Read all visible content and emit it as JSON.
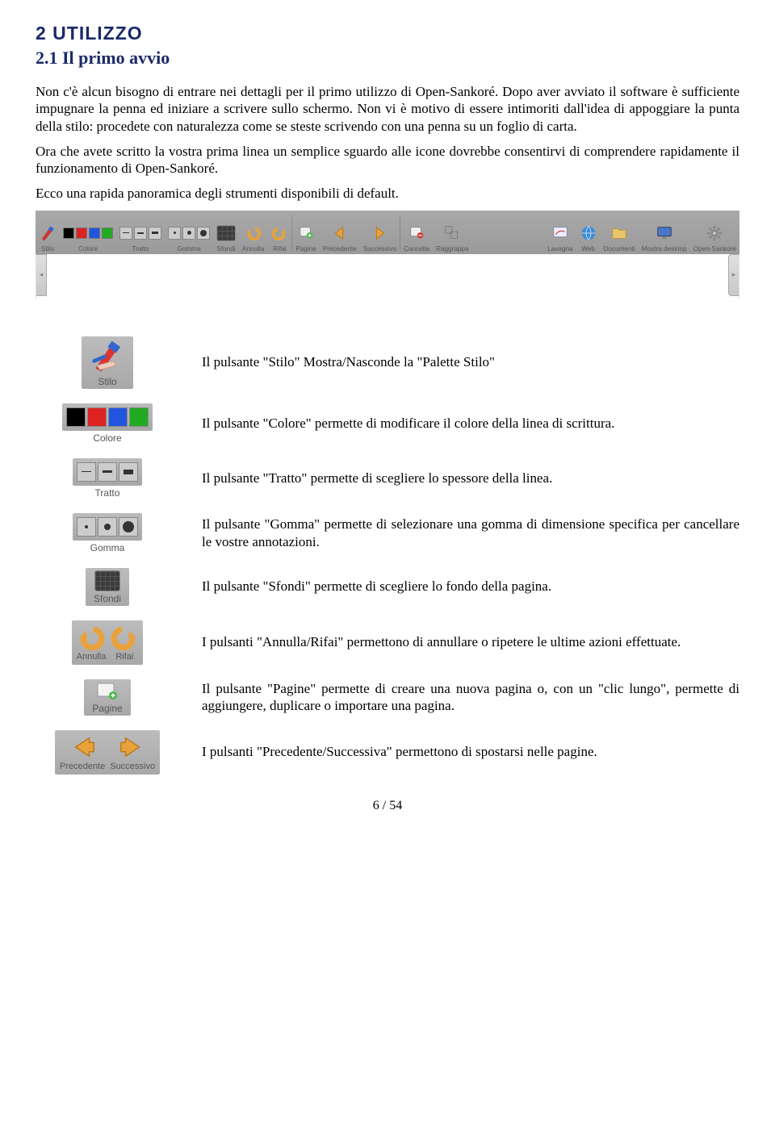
{
  "headings": {
    "h1": "2  UTILIZZO",
    "h2": "2.1 Il primo avvio"
  },
  "paragraphs": {
    "p1": "Non c'è alcun bisogno di entrare nei dettagli per il primo utilizzo di Open-Sankoré. Dopo aver avviato il software è sufficiente impugnare la penna ed iniziare a scrivere sullo schermo. Non vi è motivo di essere intimoriti dall'idea di appoggiare la punta della stilo: procedete con naturalezza come se steste scrivendo con una penna su un foglio di carta.",
    "p2": "Ora che avete scritto la vostra prima linea un semplice sguardo alle icone dovrebbe consentirvi di comprendere rapidamente il funzionamento di Open-Sankoré.",
    "p3": "Ecco una rapida panoramica degli strumenti disponibili di default."
  },
  "toolbar": {
    "stilo": "Stilo",
    "colore": "Colore",
    "tratto": "Tratto",
    "gomma": "Gomma",
    "sfondi": "Sfondi",
    "annulla": "Annulla",
    "rifai": "Rifai",
    "pagine": "Pagine",
    "precedente": "Precedente",
    "successivo": "Successivo",
    "cancella": "Cancella",
    "raggruppa": "Raggruppa",
    "lavagna": "Lavagna",
    "web": "Web",
    "documenti": "Documenti",
    "mostra_desktop": "Mostra desktop",
    "open_sankore": "Open-Sankoré"
  },
  "descs": {
    "stilo": "Il pulsante \"Stilo\" Mostra/Nasconde la \"Palette Stilo\"",
    "colore": "Il pulsante \"Colore\" permette di modificare il colore della linea di scrittura.",
    "tratto": "Il pulsante \"Tratto\" permette di scegliere lo spessore della linea.",
    "gomma": "Il pulsante \"Gomma\" permette di selezionare una gomma di dimensione specifica per cancellare le vostre annotazioni.",
    "sfondi": "Il pulsante \"Sfondi\" permette di scegliere lo fondo della pagina.",
    "annulla_rifai": "I pulsanti \"Annulla/Rifai\" permettono di annullare o ripetere le ultime azioni effettuate.",
    "pagine": "Il pulsante \"Pagine\" permette di creare una nuova pagina o, con un \"clic lungo\", permette di aggiungere, duplicare o importare una pagina.",
    "prec_succ": "I pulsanti \"Precedente/Successiva\" permettono di spostarsi nelle pagine."
  },
  "labels": {
    "stilo": "Stilo",
    "colore": "Colore",
    "tratto": "Tratto",
    "gomma": "Gomma",
    "sfondi": "Sfondi",
    "annulla": "Annulla",
    "rifai": "Rifai",
    "pagine": "Pagine",
    "precedente": "Precedente",
    "successivo": "Successivo"
  },
  "footer": {
    "page": "6 / 54"
  }
}
